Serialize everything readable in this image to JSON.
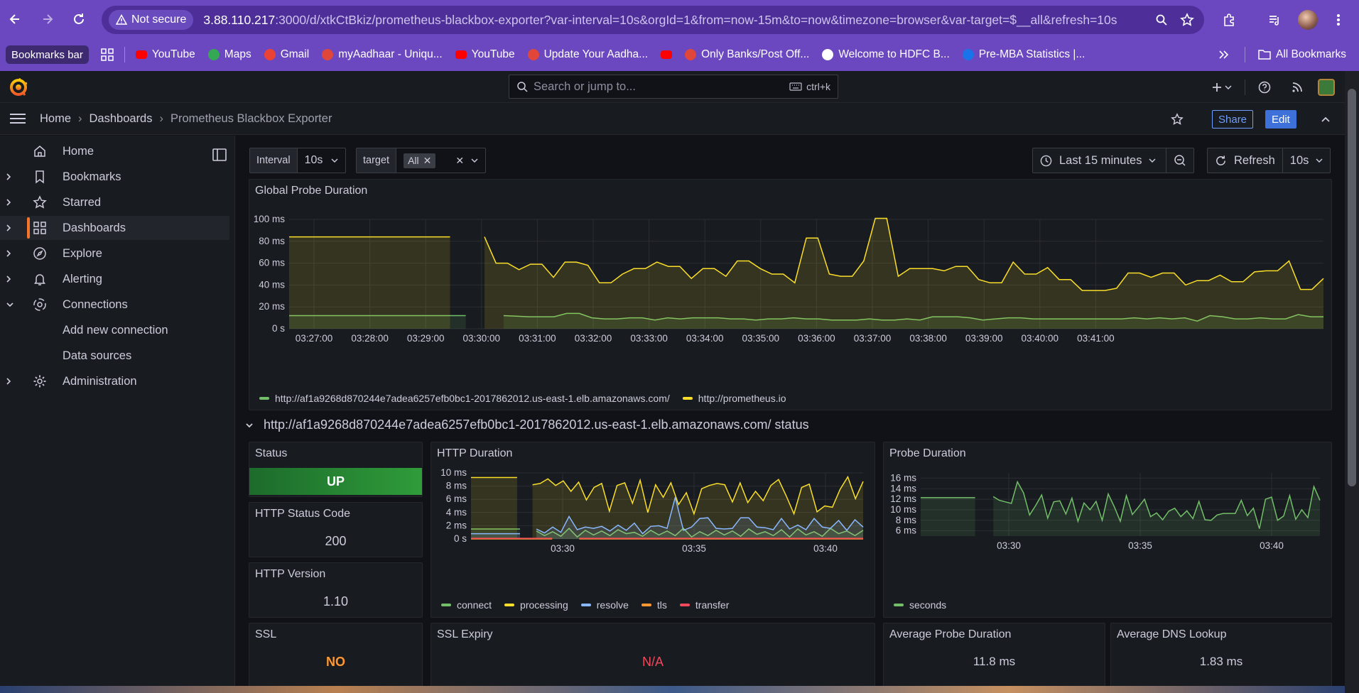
{
  "browser": {
    "security_label": "Not secure",
    "url_host": "3.88.110.217",
    "url_rest": ":3000/d/xtkCtBkiz/prometheus-blackbox-exporter?var-interval=10s&orgId=1&from=now-15m&to=now&timezone=browser&var-target=$__all&refresh=10s",
    "bookmarks_bar_label": "Bookmarks bar",
    "bookmarks": [
      {
        "label": "YouTube",
        "color": "#ff0000"
      },
      {
        "label": "Maps",
        "color": "#34a853"
      },
      {
        "label": "Gmail",
        "color": "#ea4335"
      },
      {
        "label": "myAadhaar - Uniqu...",
        "color": "#e0463a"
      },
      {
        "label": "YouTube",
        "color": "#ff0000"
      },
      {
        "label": "Update Your Aadha...",
        "color": "#e0463a"
      },
      {
        "label": "",
        "color": "#ff0000"
      },
      {
        "label": "Only Banks/Post Off...",
        "color": "#e0463a"
      },
      {
        "label": "Welcome to HDFC B...",
        "color": "#ffffff"
      },
      {
        "label": "Pre-MBA Statistics |...",
        "color": "#1a73e8"
      }
    ],
    "all_bookmarks_label": "All Bookmarks"
  },
  "grafana": {
    "search_placeholder": "Search or jump to...",
    "search_shortcut": "ctrl+k",
    "breadcrumbs": [
      "Home",
      "Dashboards",
      "Prometheus Blackbox Exporter"
    ],
    "share_label": "Share",
    "edit_label": "Edit",
    "sidebar": [
      {
        "label": "Home",
        "icon": "home-icon",
        "chevron": ""
      },
      {
        "label": "Bookmarks",
        "icon": "bookmark-icon",
        "chevron": "›"
      },
      {
        "label": "Starred",
        "icon": "star-icon",
        "chevron": "›"
      },
      {
        "label": "Dashboards",
        "icon": "dashboards-icon",
        "chevron": "›"
      },
      {
        "label": "Explore",
        "icon": "compass-icon",
        "chevron": "›"
      },
      {
        "label": "Alerting",
        "icon": "bell-icon",
        "chevron": "›"
      },
      {
        "label": "Connections",
        "icon": "connections-icon",
        "chevron": "⌄"
      },
      {
        "label": "Add new connection",
        "icon": "",
        "chevron": ""
      },
      {
        "label": "Data sources",
        "icon": "",
        "chevron": ""
      },
      {
        "label": "Administration",
        "icon": "gear-icon",
        "chevron": "›"
      }
    ],
    "variables": {
      "interval_label": "Interval",
      "interval_value": "10s",
      "target_label": "target",
      "target_value": "All"
    },
    "time_range": "Last 15 minutes",
    "refresh_label": "Refresh",
    "refresh_interval": "10s",
    "row_title": "http://af1a9268d870244e7adea6257efb0bc1-2017862012.us-east-1.elb.amazonaws.com/ status",
    "stats": {
      "status_title": "Status",
      "status_value": "UP",
      "http_status_title": "HTTP Status Code",
      "http_status_value": "200",
      "http_version_title": "HTTP Version",
      "http_version_value": "1.10",
      "ssl_title": "SSL",
      "ssl_value": "NO",
      "ssl_expiry_title": "SSL Expiry",
      "ssl_expiry_value": "N/A",
      "avg_probe_title": "Average Probe Duration",
      "avg_probe_value": "11.8 ms",
      "avg_dns_title": "Average DNS Lookup",
      "avg_dns_value": "1.83 ms"
    },
    "colors": {
      "green": "#73bf69",
      "yellow": "#fade2a",
      "blue": "#8ab8ff",
      "orange": "#ff9830",
      "red": "#f2495c",
      "accent": "#f5762a"
    }
  },
  "chart_data": [
    {
      "type": "area",
      "title": "Global Probe Duration",
      "x": [
        "03:27:00",
        "03:28:00",
        "03:29:00",
        "03:30:00",
        "03:31:00",
        "03:32:00",
        "03:33:00",
        "03:34:00",
        "03:35:00",
        "03:36:00",
        "03:37:00",
        "03:38:00",
        "03:39:00",
        "03:40:00",
        "03:41:00"
      ],
      "y_ticks": [
        "0 s",
        "20 ms",
        "40 ms",
        "60 ms",
        "80 ms",
        "100 ms"
      ],
      "ylim": [
        0,
        100
      ],
      "series": [
        {
          "name": "http://af1a9268d870244e7adea6257efb0bc1-2017862012.us-east-1.elb.amazonaws.com/",
          "color": "#73bf69",
          "values": [
            12,
            12,
            12,
            12,
            12,
            12,
            12,
            12,
            12,
            12,
            12,
            12,
            12,
            12,
            12,
            null,
            null,
            12,
            11.5,
            11,
            11,
            11,
            14,
            14,
            10,
            9,
            9,
            10,
            10,
            8,
            10,
            9,
            10,
            10,
            10,
            9,
            9,
            8,
            9,
            9,
            10,
            9,
            9,
            8,
            8,
            8,
            9,
            8,
            8,
            9,
            8,
            11,
            11,
            11,
            10,
            8,
            9,
            10,
            10,
            9,
            9,
            9,
            9,
            9,
            9,
            9,
            9,
            10,
            9,
            10,
            9,
            10,
            7,
            12,
            11,
            9,
            9,
            10,
            9,
            9,
            13,
            11,
            11
          ]
        },
        {
          "name": "http://prometheus.io",
          "color": "#fade2a",
          "values": [
            84,
            84,
            84,
            84,
            84,
            84,
            84,
            84,
            84,
            84,
            84,
            84,
            84,
            84,
            84,
            null,
            null,
            84,
            60,
            60,
            54,
            59,
            59,
            47,
            61,
            61,
            58,
            42,
            42,
            50,
            55,
            55,
            61,
            57,
            57,
            46,
            55,
            55,
            48,
            62,
            62,
            55,
            50,
            50,
            42,
            83,
            83,
            50,
            48,
            48,
            62,
            101,
            101,
            48,
            55,
            55,
            55,
            53,
            57,
            57,
            45,
            42,
            42,
            61,
            50,
            50,
            56,
            45,
            45,
            35,
            35,
            35,
            37,
            51,
            51,
            47,
            51,
            51,
            40,
            44,
            44,
            49,
            43,
            43,
            52,
            53,
            53,
            62,
            36,
            36,
            46
          ]
        }
      ]
    },
    {
      "type": "area",
      "title": "HTTP Duration",
      "x": [
        "03:30",
        "03:35",
        "03:40"
      ],
      "y_ticks": [
        "0 s",
        "2 ms",
        "4 ms",
        "6 ms",
        "8 ms",
        "10 ms"
      ],
      "ylim": [
        0,
        10
      ],
      "series": [
        {
          "name": "connect",
          "color": "#73bf69",
          "values": [
            1.5,
            1.5,
            1.5,
            1.5,
            1.5,
            1.5,
            1.5,
            null,
            1.2,
            0.5,
            1.1,
            0.4,
            1.6,
            0.3,
            1.3,
            0.6,
            1.2,
            0.5,
            1.4,
            0.8,
            1,
            0.4,
            1.3,
            0.6,
            1.2,
            0.5,
            1.6,
            0.3,
            1.1,
            0.5,
            1.3,
            0.6,
            1.2,
            0.4,
            1.5,
            0.7,
            1.1,
            0.5,
            1.4,
            0.3,
            1.5,
            0.6,
            1.1,
            0.4,
            1.6,
            0.8,
            1.2,
            0.5,
            1.3
          ]
        },
        {
          "name": "processing",
          "color": "#fade2a",
          "values": [
            9.3,
            9.3,
            9.3,
            9.3,
            9.3,
            9.3,
            9.3,
            null,
            8.2,
            8.4,
            9.1,
            8.1,
            8.8,
            7.2,
            8.6,
            5.9,
            7.8,
            8.4,
            4.2,
            8.1,
            8.5,
            5.4,
            8.9,
            4,
            8.2,
            6.3,
            8.5,
            5.2,
            7,
            3.8,
            7.6,
            8.1,
            8.4,
            8.2,
            5.6,
            8.5,
            5.5,
            7.2,
            5.8,
            8.1,
            9,
            6.5,
            3.8,
            7.8,
            8.3,
            4.1,
            5,
            4.8,
            7.5,
            9.4,
            6.1,
            8.7
          ]
        },
        {
          "name": "resolve",
          "color": "#8ab8ff",
          "values": [
            0.8,
            0.8,
            0.8,
            0.8,
            0.8,
            0.8,
            0.8,
            null,
            1.5,
            0.9,
            1.8,
            1,
            3.4,
            1.4,
            1.8,
            1.6,
            1.9,
            1.2,
            2.1,
            1.3,
            2.4,
            0.8,
            1.9,
            2,
            1.6,
            6.3,
            1.3,
            1.8,
            3.1,
            3.2,
            1.6,
            1.5,
            1.6,
            3.2,
            3.2,
            1.8,
            1.7,
            1.4,
            3.1,
            1.5,
            2.1,
            1.4,
            3.1,
            1.8,
            1.6,
            2.8,
            1.3,
            2.9,
            1.8
          ]
        },
        {
          "name": "tls",
          "color": "#ff9830",
          "values": [
            0,
            0,
            0,
            0,
            0,
            0,
            0,
            null,
            0,
            0,
            0,
            0,
            0,
            0,
            0,
            0,
            0,
            0,
            0,
            0,
            0,
            0,
            0,
            0,
            0,
            0,
            0,
            0,
            0,
            0
          ]
        },
        {
          "name": "transfer",
          "color": "#f2495c",
          "values": [
            0.1,
            0.1,
            0.1,
            0.1,
            0.1,
            0.1,
            0.1,
            null,
            0.1,
            0.1,
            0.1,
            0.1,
            0.1,
            0.1,
            0.1,
            0.1,
            0.1,
            0.1,
            0.1,
            0.1,
            0.1,
            0.1,
            0.1,
            0.1,
            0.1,
            0.1,
            0.1,
            0.1,
            0.1,
            0.1
          ]
        }
      ]
    },
    {
      "type": "area",
      "title": "Probe Duration",
      "x": [
        "03:30",
        "03:35",
        "03:40"
      ],
      "y_ticks": [
        "6 ms",
        "8 ms",
        "10 ms",
        "12 ms",
        "14 ms",
        "16 ms"
      ],
      "ylim": [
        5,
        17
      ],
      "series": [
        {
          "name": "seconds",
          "color": "#73bf69",
          "values": [
            12.3,
            12.3,
            12.3,
            12.3,
            12.3,
            12.3,
            12.3,
            12.3,
            12.3,
            12.3,
            null,
            null,
            12.5,
            11.8,
            11.5,
            11.2,
            15.3,
            13.2,
            9,
            10.8,
            12.8,
            8.4,
            11.5,
            11.7,
            9.2,
            12.2,
            7.8,
            11.3,
            10,
            11.6,
            8,
            13,
            10.6,
            7.8,
            12.7,
            9.1,
            10.5,
            12,
            8.7,
            9.4,
            8.1,
            9.7,
            10.3,
            8.7,
            9.8,
            8.3,
            11.6,
            8.1,
            8,
            9,
            9.3,
            9.3,
            9.3,
            11.8,
            8.9,
            10.3,
            6.4,
            12,
            12.4,
            8,
            8.8,
            12.7,
            8.2,
            10,
            8.5,
            14.4,
            11.8
          ]
        }
      ]
    }
  ]
}
